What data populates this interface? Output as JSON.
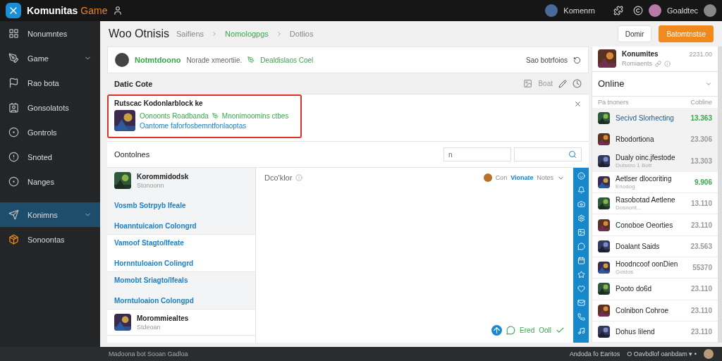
{
  "topbar": {
    "brand": "Komunitas",
    "brand_accent": "Game",
    "user1": "Komenrn",
    "user2": "Goaldtec"
  },
  "sidebar": {
    "items": [
      {
        "label": "Nonumntes",
        "caret": false,
        "selected": false
      },
      {
        "label": "Game",
        "caret": true,
        "selected": false
      },
      {
        "label": "Rao bota",
        "caret": false,
        "selected": false
      },
      {
        "label": "Gonsolatots",
        "caret": false,
        "selected": false
      },
      {
        "label": "Gontrols",
        "caret": false,
        "selected": false
      },
      {
        "label": "Snoted",
        "caret": false,
        "selected": false
      },
      {
        "label": "Nanges",
        "caret": false,
        "selected": false
      },
      {
        "label": "Konimns",
        "caret": true,
        "selected": true
      },
      {
        "label": "Sonoontas",
        "caret": false,
        "selected": false
      }
    ]
  },
  "header": {
    "title": "Woo Otnisis",
    "crumbs": [
      "Saifiens",
      "Nomologpgs",
      "Dotlios"
    ],
    "buttons": [
      {
        "label": "Domir",
        "kind": "plain"
      },
      {
        "label": "Batomtnstse",
        "kind": "primary"
      }
    ]
  },
  "profile": {
    "name": "Notmtdoono",
    "text": "Norade xmeortiie.",
    "link": "Dealdislaos Coel",
    "action": "Sao botrfoios"
  },
  "section": {
    "title": "Datic Cote",
    "action": "Boat"
  },
  "highlight": {
    "title": "Rutscac Kodonlarblock ke",
    "line1": "Oonoonts Roadbanda",
    "line2": "Mnonimoomins ctbes",
    "line3": "Oantome faforfosbemntfonlaoptas"
  },
  "filter": {
    "title": "Oontolnes",
    "field": "n"
  },
  "list": {
    "groups": [
      {
        "shaded": true,
        "entries": [
          {
            "kind": "game",
            "title": "Korommidodsk",
            "subtitle": "Stonoonn"
          },
          {
            "kind": "link",
            "text": "Vosmb Sotrpyb Ifeale"
          },
          {
            "kind": "link",
            "text": "Hoanntuicaion Colongrd"
          }
        ]
      },
      {
        "shaded": false,
        "entries": [
          {
            "kind": "link",
            "text": "Vamoof Stagto/Ifeate"
          },
          {
            "kind": "link",
            "text": "Hornntuloaion Colingrd"
          }
        ]
      },
      {
        "shaded": true,
        "entries": [
          {
            "kind": "link",
            "text": "Momobt Sriagto/Ifeals"
          },
          {
            "kind": "link",
            "text": "Morntuloaion Colongpd"
          }
        ]
      },
      {
        "shaded": false,
        "entries": [
          {
            "kind": "game",
            "title": "Morommiealtes",
            "subtitle": "Stdeoan"
          }
        ]
      }
    ]
  },
  "chat": {
    "title": "Dco'klor",
    "who": "Con",
    "who_link": "Vionate",
    "who_after": "Notes",
    "footer_a": "Ered",
    "footer_b": "Ooll"
  },
  "right": {
    "name": "Konumites",
    "time": "2231.00",
    "sub": "Romiaents",
    "heading": "Online",
    "col1": "Pa tnoners",
    "col2": "Cobline",
    "rows": [
      {
        "title": "Secivd Slorhecting",
        "sub": "",
        "value": "13.363",
        "color": "#3aa64a",
        "selected": true
      },
      {
        "title": "Rbodortiona",
        "sub": "",
        "value": "23.306",
        "color": "#9a9a9a",
        "selected": true
      },
      {
        "title": "Dualy oinc.jfestode",
        "sub": "Dutsero 1 Bott",
        "value": "13.303",
        "color": "#9a9a9a",
        "selected": true
      },
      {
        "title": "Aetlser dlocoriting",
        "sub": "Enodog",
        "value": "9.906",
        "color": "#3aa64a",
        "selected": false
      },
      {
        "title": "Rasobotad Aetlene",
        "sub": "Dosnont...",
        "value": "13.110",
        "color": "#9a9a9a",
        "selected": false
      },
      {
        "title": "Conoboe Oeorties",
        "sub": "",
        "value": "23.110",
        "color": "#9a9a9a",
        "selected": false
      },
      {
        "title": "Doalant Saids",
        "sub": "",
        "value": "23.563",
        "color": "#9a9a9a",
        "selected": false
      },
      {
        "title": "Hoodncoof oonDien",
        "sub": "Gostos",
        "value": "55370",
        "color": "#9a9a9a",
        "selected": false
      },
      {
        "title": "Pooto do6d",
        "sub": "",
        "value": "23.110",
        "color": "#9a9a9a",
        "selected": false
      },
      {
        "title": "Colnibon Cohroe",
        "sub": "",
        "value": "23.110",
        "color": "#9a9a9a",
        "selected": false
      },
      {
        "title": "Dohus Iilend",
        "sub": "",
        "value": "23.110",
        "color": "#9a9a9a",
        "selected": false
      }
    ]
  },
  "footer": {
    "left": "Madoona bot Sooan Gadloa",
    "right_a": "Andoda fo Earitos",
    "right_b": "O Oavbdlof oanbdam ▾ •"
  }
}
